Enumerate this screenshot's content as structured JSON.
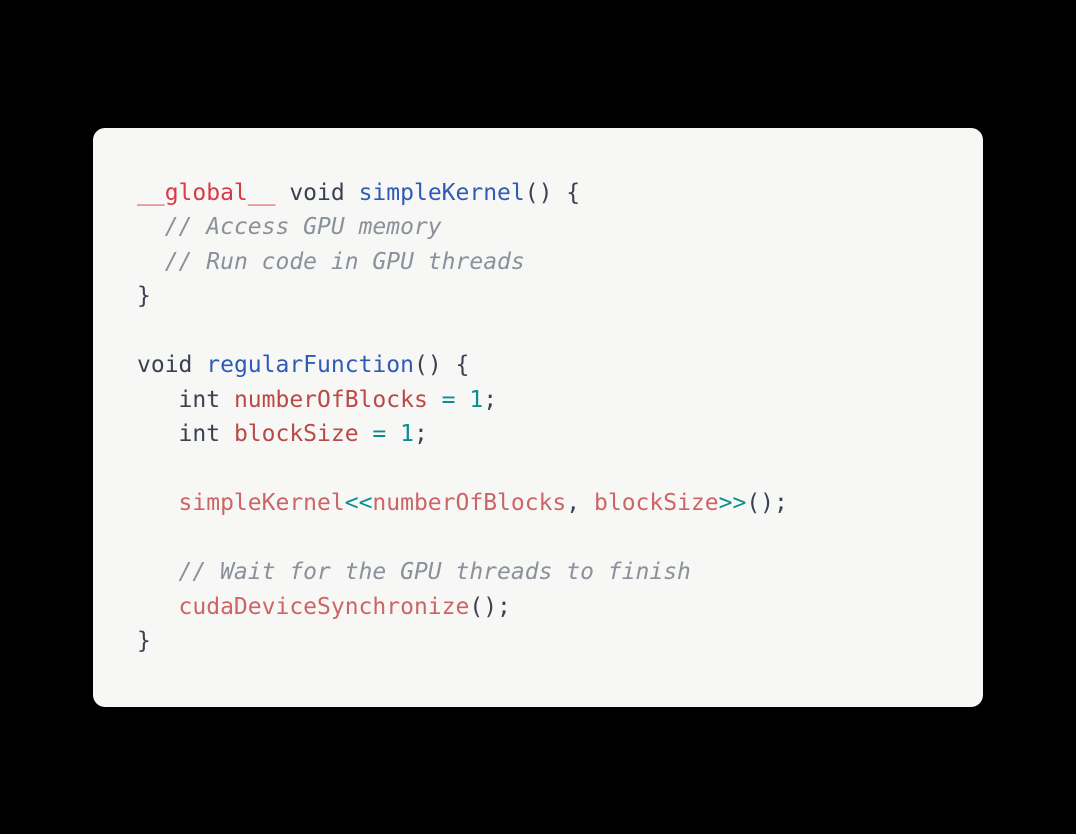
{
  "code": {
    "tokens": [
      {
        "cls": "kw-red",
        "t": "__global__"
      },
      {
        "cls": "plain",
        "t": " void "
      },
      {
        "cls": "fn-blue",
        "t": "simpleKernel"
      },
      {
        "cls": "plain",
        "t": "() {\n  "
      },
      {
        "cls": "comment",
        "t": "// Access GPU memory"
      },
      {
        "cls": "plain",
        "t": "\n  "
      },
      {
        "cls": "comment",
        "t": "// Run code in GPU threads"
      },
      {
        "cls": "plain",
        "t": "\n}\n\nvoid "
      },
      {
        "cls": "fn-blue",
        "t": "regularFunction"
      },
      {
        "cls": "plain",
        "t": "() {\n   int "
      },
      {
        "cls": "var-red",
        "t": "numberOfBlocks"
      },
      {
        "cls": "plain",
        "t": " "
      },
      {
        "cls": "op-teal",
        "t": "="
      },
      {
        "cls": "plain",
        "t": " "
      },
      {
        "cls": "num-teal",
        "t": "1"
      },
      {
        "cls": "plain",
        "t": ";\n   int "
      },
      {
        "cls": "var-red",
        "t": "blockSize"
      },
      {
        "cls": "plain",
        "t": " "
      },
      {
        "cls": "op-teal",
        "t": "="
      },
      {
        "cls": "plain",
        "t": " "
      },
      {
        "cls": "num-teal",
        "t": "1"
      },
      {
        "cls": "plain",
        "t": ";\n\n   "
      },
      {
        "cls": "call-pink",
        "t": "simpleKernel"
      },
      {
        "cls": "angle-teal",
        "t": "<<"
      },
      {
        "cls": "call-pink",
        "t": "numberOfBlocks"
      },
      {
        "cls": "plain",
        "t": ", "
      },
      {
        "cls": "call-pink",
        "t": "blockSize"
      },
      {
        "cls": "angle-teal",
        "t": ">>"
      },
      {
        "cls": "plain",
        "t": "();\n\n   "
      },
      {
        "cls": "comment",
        "t": "// Wait for the GPU threads to finish"
      },
      {
        "cls": "plain",
        "t": "\n   "
      },
      {
        "cls": "call-pink",
        "t": "cudaDeviceSynchronize"
      },
      {
        "cls": "plain",
        "t": "();\n}"
      }
    ]
  }
}
